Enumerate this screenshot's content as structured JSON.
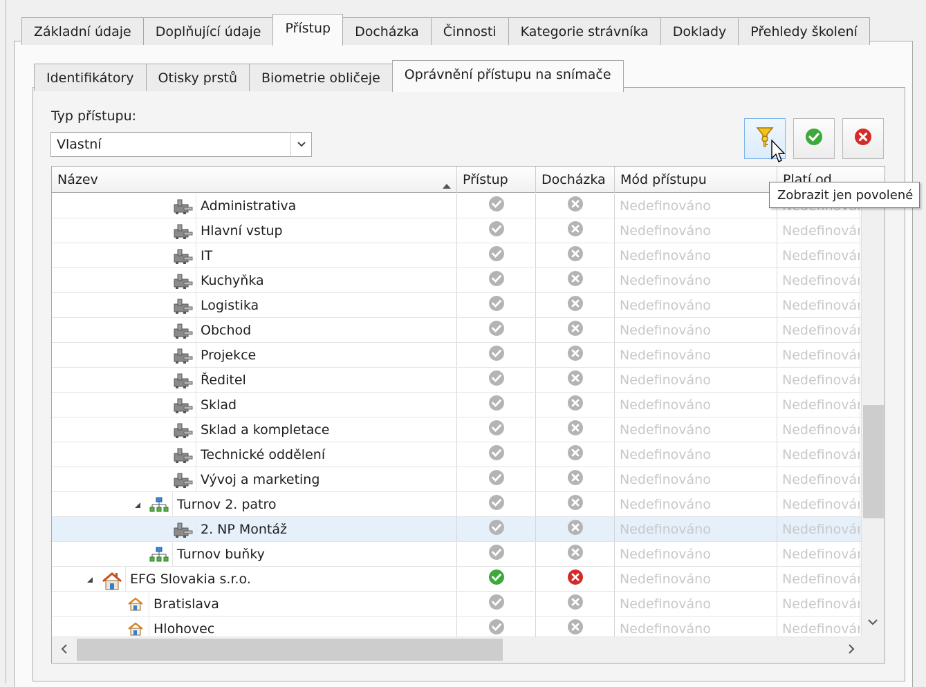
{
  "main_tabs": [
    {
      "label": "Základní údaje",
      "active": false
    },
    {
      "label": "Doplňující údaje",
      "active": false
    },
    {
      "label": "Přístup",
      "active": true
    },
    {
      "label": "Docházka",
      "active": false
    },
    {
      "label": "Činnosti",
      "active": false
    },
    {
      "label": "Kategorie strávníka",
      "active": false
    },
    {
      "label": "Doklady",
      "active": false
    },
    {
      "label": "Přehledy školení",
      "active": false
    }
  ],
  "sub_tabs": [
    {
      "label": "Identifikátory",
      "active": false
    },
    {
      "label": "Otisky prstů",
      "active": false
    },
    {
      "label": "Biometrie obličeje",
      "active": false
    },
    {
      "label": "Oprávnění přístupu na snímače",
      "active": true
    }
  ],
  "access_type": {
    "label": "Typ přístupu:",
    "value": "Vlastní"
  },
  "toolbar": {
    "tooltip": "Zobrazit jen povolené",
    "filter_icon": "key-filter-icon",
    "accept_icon": "green-check-icon",
    "reject_icon": "red-x-icon"
  },
  "columns": {
    "name": "Název",
    "access": "Přístup",
    "attendance": "Docházka",
    "mode": "Mód přístupu",
    "valid_from": "Platí od"
  },
  "rows": [
    {
      "name": "Administrativa",
      "level": 3,
      "icon": "reader-icon",
      "expander": false,
      "access": "gray-check",
      "attendance": "gray-x",
      "mode": "Nedefinováno",
      "valid": "Nedefinováno"
    },
    {
      "name": "Hlavní vstup",
      "level": 3,
      "icon": "reader-icon",
      "expander": false,
      "access": "gray-check",
      "attendance": "gray-x",
      "mode": "Nedefinováno",
      "valid": "Nedefinováno"
    },
    {
      "name": "IT",
      "level": 3,
      "icon": "reader-icon",
      "expander": false,
      "access": "gray-check",
      "attendance": "gray-x",
      "mode": "Nedefinováno",
      "valid": "Nedefinováno"
    },
    {
      "name": "Kuchyňka",
      "level": 3,
      "icon": "reader-icon",
      "expander": false,
      "access": "gray-check",
      "attendance": "gray-x",
      "mode": "Nedefinováno",
      "valid": "Nedefinováno"
    },
    {
      "name": "Logistika",
      "level": 3,
      "icon": "reader-icon",
      "expander": false,
      "access": "gray-check",
      "attendance": "gray-x",
      "mode": "Nedefinováno",
      "valid": "Nedefinováno"
    },
    {
      "name": "Obchod",
      "level": 3,
      "icon": "reader-icon",
      "expander": false,
      "access": "gray-check",
      "attendance": "gray-x",
      "mode": "Nedefinováno",
      "valid": "Nedefinováno"
    },
    {
      "name": "Projekce",
      "level": 3,
      "icon": "reader-icon",
      "expander": false,
      "access": "gray-check",
      "attendance": "gray-x",
      "mode": "Nedefinováno",
      "valid": "Nedefinováno"
    },
    {
      "name": "Ředitel",
      "level": 3,
      "icon": "reader-icon",
      "expander": false,
      "access": "gray-check",
      "attendance": "gray-x",
      "mode": "Nedefinováno",
      "valid": "Nedefinováno"
    },
    {
      "name": "Sklad",
      "level": 3,
      "icon": "reader-icon",
      "expander": false,
      "access": "gray-check",
      "attendance": "gray-x",
      "mode": "Nedefinováno",
      "valid": "Nedefinováno"
    },
    {
      "name": "Sklad a kompletace",
      "level": 3,
      "icon": "reader-icon",
      "expander": false,
      "access": "gray-check",
      "attendance": "gray-x",
      "mode": "Nedefinováno",
      "valid": "Nedefinováno"
    },
    {
      "name": "Technické oddělení",
      "level": 3,
      "icon": "reader-icon",
      "expander": false,
      "access": "gray-check",
      "attendance": "gray-x",
      "mode": "Nedefinováno",
      "valid": "Nedefinováno"
    },
    {
      "name": "Vývoj a marketing",
      "level": 3,
      "icon": "reader-icon",
      "expander": false,
      "access": "gray-check",
      "attendance": "gray-x",
      "mode": "Nedefinováno",
      "valid": "Nedefinováno"
    },
    {
      "name": "Turnov 2. patro",
      "level": 2,
      "icon": "network-icon",
      "expander": true,
      "access": "gray-check",
      "attendance": "gray-x",
      "mode": "Nedefinováno",
      "valid": "Nedefinováno"
    },
    {
      "name": "2. NP Montáž",
      "level": 3,
      "icon": "reader-icon",
      "expander": false,
      "selected": true,
      "access": "gray-check",
      "attendance": "gray-x",
      "mode": "Nedefinováno",
      "valid": "Nedefinováno"
    },
    {
      "name": "Turnov buňky",
      "level": 2,
      "icon": "network-icon",
      "expander": false,
      "access": "gray-check",
      "attendance": "gray-x",
      "mode": "Nedefinováno",
      "valid": "Nedefinováno"
    },
    {
      "name": "EFG Slovakia s.r.o.",
      "level": 0,
      "icon": "company-icon",
      "expander": true,
      "access": "green-check",
      "attendance": "red-x",
      "mode": "Nedefinováno",
      "valid": "Nedefinováno"
    },
    {
      "name": "Bratislava",
      "level": 1,
      "icon": "building-icon",
      "expander": false,
      "access": "gray-check",
      "attendance": "gray-x",
      "mode": "Nedefinováno",
      "valid": "Nedefinováno"
    },
    {
      "name": "Hlohovec",
      "level": 1,
      "icon": "building-icon",
      "expander": false,
      "access": "gray-check",
      "attendance": "gray-x",
      "mode": "Nedefinováno",
      "valid": "Nedefinováno"
    }
  ]
}
